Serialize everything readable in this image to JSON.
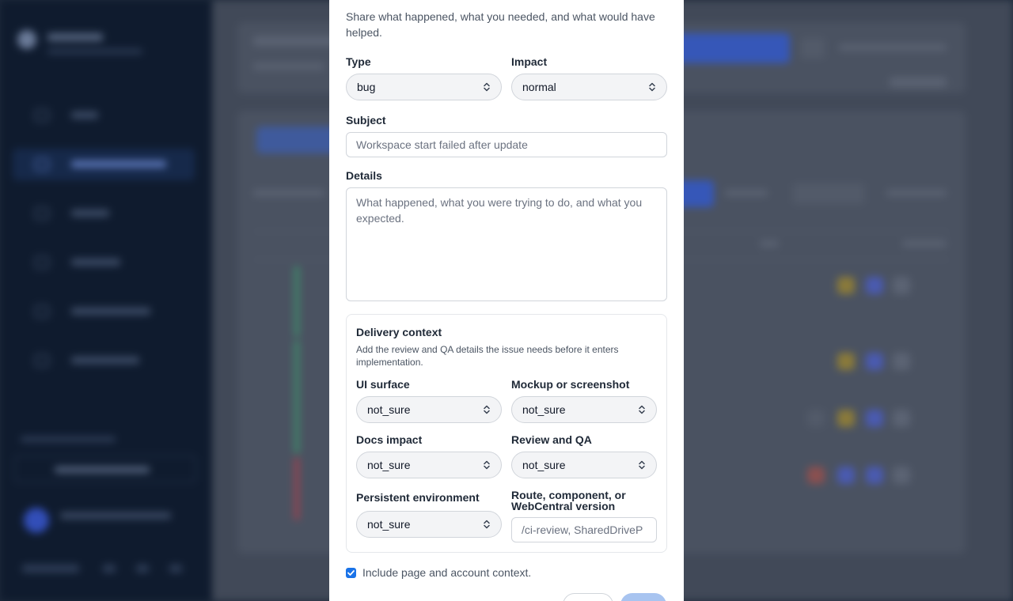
{
  "modal": {
    "intro": "Share what happened, what you needed, and what would have helped.",
    "type": {
      "label": "Type",
      "value": "bug"
    },
    "impact": {
      "label": "Impact",
      "value": "normal"
    },
    "subject": {
      "label": "Subject",
      "placeholder": "Workspace start failed after update"
    },
    "details": {
      "label": "Details",
      "placeholder": "What happened, what you were trying to do, and what you expected."
    },
    "delivery": {
      "title": "Delivery context",
      "description": "Add the review and QA details the issue needs before it enters implementation.",
      "ui_surface": {
        "label": "UI surface",
        "value": "not_sure"
      },
      "mockup": {
        "label": "Mockup or screenshot",
        "value": "not_sure"
      },
      "docs_impact": {
        "label": "Docs impact",
        "value": "not_sure"
      },
      "review_qa": {
        "label": "Review and QA",
        "value": "not_sure"
      },
      "persistent_env": {
        "label": "Persistent environment",
        "value": "not_sure"
      },
      "route": {
        "label": "Route, component, or WebCentral version",
        "placeholder": "/ci-review, SharedDriveP"
      }
    },
    "include_context": {
      "label": "Include page and account context.",
      "checked": true
    }
  },
  "colors": {
    "accent": "#1a73e8",
    "overlay": "#414958",
    "sidebar": "#0f1b2e"
  }
}
